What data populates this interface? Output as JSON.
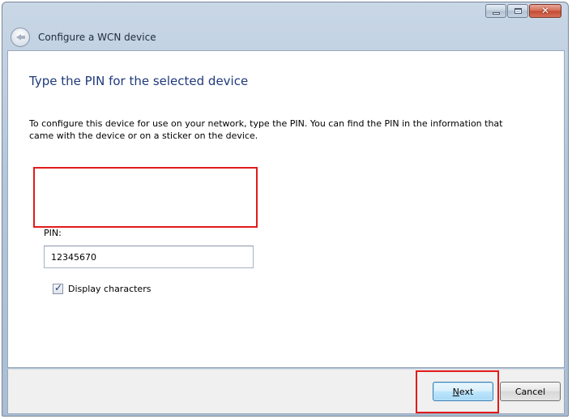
{
  "window": {
    "title": "Configure a WCN device",
    "caption_buttons": {
      "close_glyph": "✕"
    }
  },
  "content": {
    "heading": "Type the PIN for the selected device",
    "description": "To configure this device for use on your network, type the PIN. You can find the PIN in the information that came with the device or on a sticker on the device.",
    "pin_label": "PIN:",
    "pin_value": "12345670",
    "display_characters": {
      "label": "Display characters",
      "checked": true,
      "check_glyph": "✓"
    }
  },
  "footer": {
    "next_label_first": "N",
    "next_label_rest": "ext",
    "cancel_label": "Cancel"
  },
  "colors": {
    "heading": "#1f3a7a",
    "highlight": "#e21b1b",
    "next_border": "#3c7fb1"
  }
}
